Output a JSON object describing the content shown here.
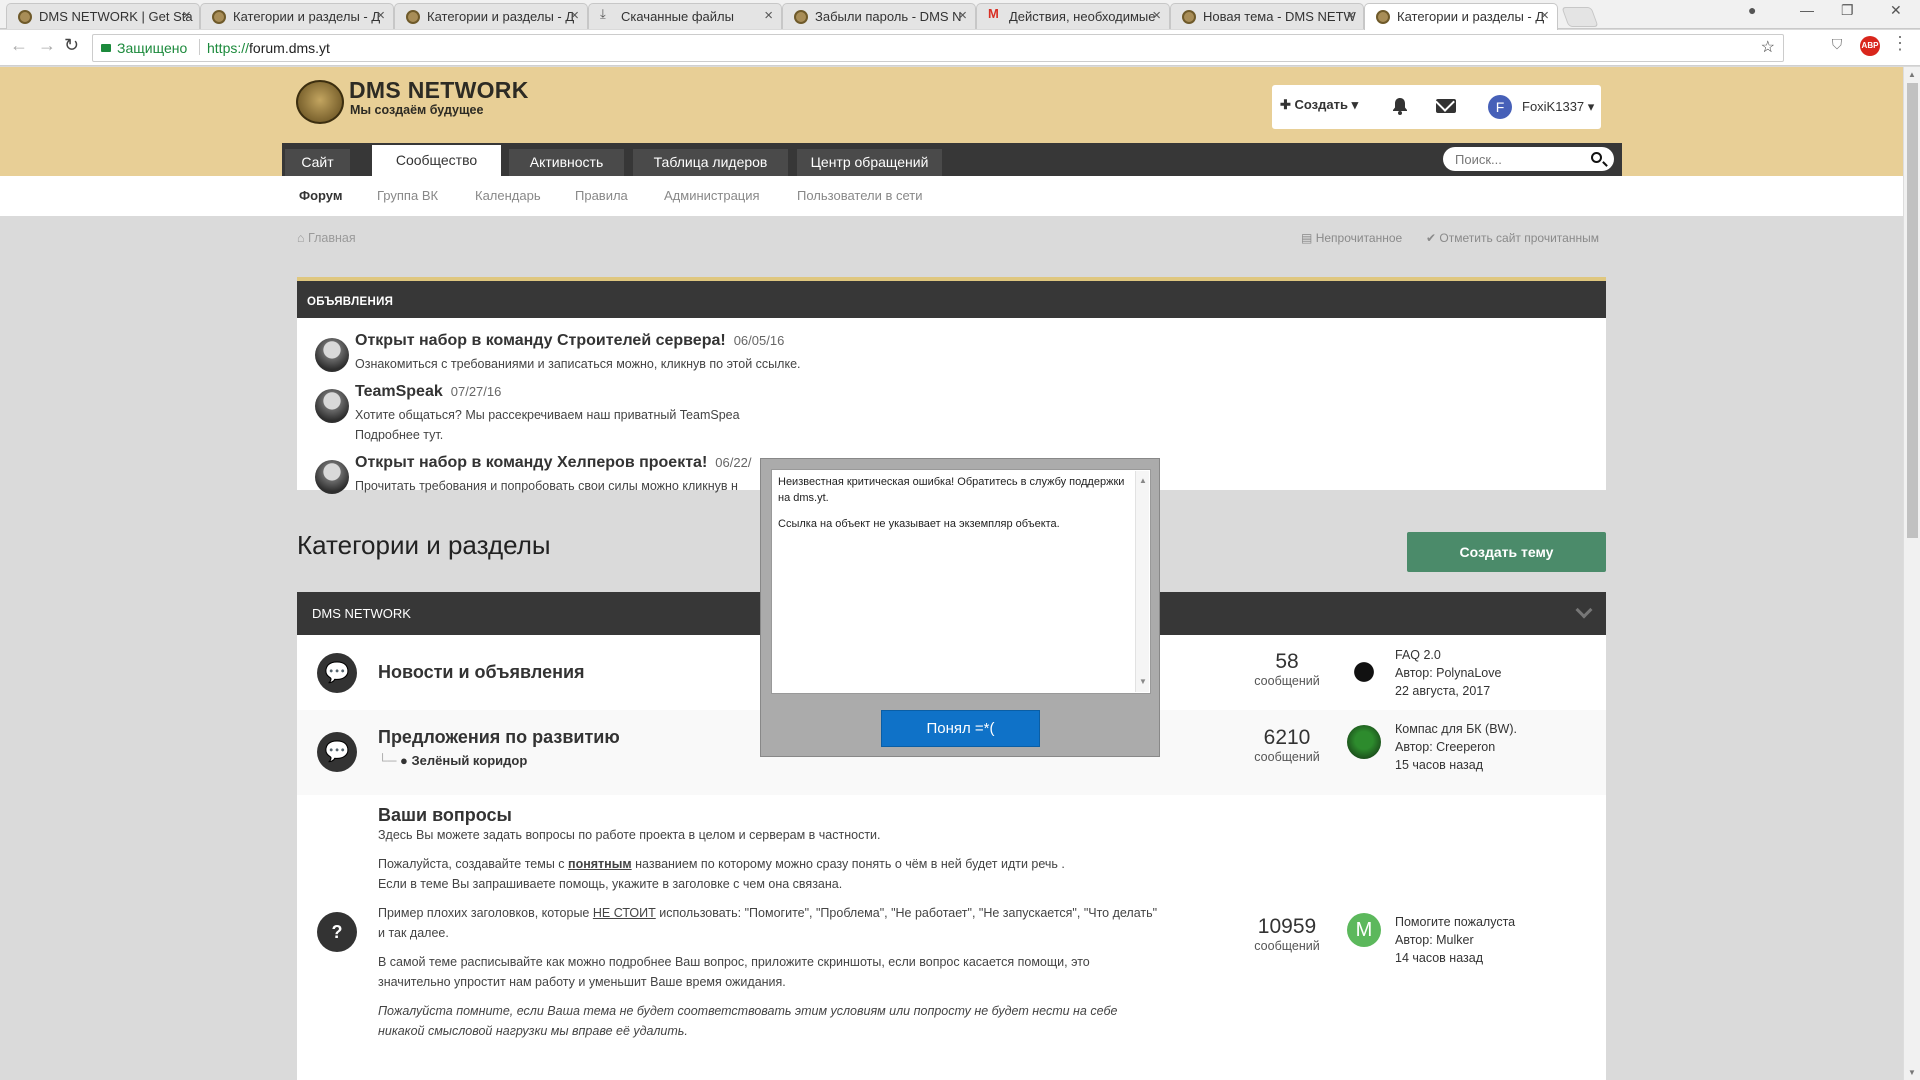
{
  "browser": {
    "tabs": [
      {
        "title": "DMS NETWORK | Get Sta"
      },
      {
        "title": "Категории и разделы - Д"
      },
      {
        "title": "Категории и разделы - Д"
      },
      {
        "title": "Скачанные файлы"
      },
      {
        "title": "Забыли пароль - DMS N"
      },
      {
        "title": "Действия, необходимые"
      },
      {
        "title": "Новая тема - DMS NETW"
      },
      {
        "title": "Категории и разделы - Д"
      }
    ],
    "secure_label": "Защищено",
    "url_scheme": "https://",
    "url_host": "forum.dms.yt"
  },
  "header": {
    "brand": "DMS NETWORK",
    "tagline": "Мы создаём будущее",
    "create_label": "Создать",
    "avatar_letter": "F",
    "username": "FoxiK1337"
  },
  "mainnav": {
    "tabs": [
      "Сайт",
      "Сообщество",
      "Активность",
      "Таблица лидеров",
      "Центр обращений"
    ],
    "search_placeholder": "Поиск..."
  },
  "subnav": [
    "Форум",
    "Группа ВК",
    "Календарь",
    "Правила",
    "Администрация",
    "Пользователи в сети"
  ],
  "breadcrumb": {
    "home": "Главная",
    "unread": "Непрочитанное",
    "mark_read": "Отметить сайт прочитанным"
  },
  "announcements": {
    "heading": "ОБЪЯВЛЕНИЯ",
    "items": [
      {
        "title": "Открыт набор в команду Строителей сервера!",
        "date": "06/05/16",
        "text": "Ознакомиться с требованиями и записаться можно, кликнув по этой ссылке."
      },
      {
        "title": "TeamSpeak",
        "date": "07/27/16",
        "text": "Хотите общаться? Мы рассекречиваем наш приватный TeamSpea",
        "text2": "Подробнее тут."
      },
      {
        "title": "Открыт набор в команду Хелперов проекта!",
        "date": "06/22/",
        "text": "Прочитать требования и попробовать свои силы можно кликнув н"
      }
    ]
  },
  "main": {
    "title": "Категории и разделы",
    "new_topic": "Создать тему",
    "category": "DMS NETWORK",
    "forums": [
      {
        "title": "Новости и объявления",
        "count": "58",
        "count_label": "сообщений",
        "last_title": "FAQ 2.0",
        "last_author": "Автор: PolynaLove",
        "last_time": "22 августа, 2017"
      },
      {
        "title": "Предложения по развитию",
        "sub": "Зелёный коридор",
        "count": "6210",
        "count_label": "сообщений",
        "last_title": "Компас для БК (BW).",
        "last_author": "Автор: Creeperon",
        "last_time": "15 часов назад"
      },
      {
        "title": "Ваши вопросы",
        "desc1": "Здесь Вы можете задать вопросы по работе проекта в целом и серверам в частности.",
        "desc2a": "Пожалуйста, создавайте темы с ",
        "desc2u": "понятным",
        "desc2b": " названием по которому можно сразу понять о чём в ней будет идти речь .",
        "desc2c": "Если в теме Вы запрашиваете помощь, укажите в заголовке с чем она связана.",
        "desc3a": "Пример плохих заголовков, которые ",
        "desc3u": "НЕ СТОИТ",
        "desc3b": " использовать: \"Помогите\",  \"Проблема\", \"Не работает\", \"Не запускается\", \"Что делать\" и так далее.",
        "desc4": "В самой теме расписывайте как можно подробнее Ваш вопрос, приложите скриншоты, если вопрос касается помощи, это значительно упростит нам работу и уменьшит Ваше время ожидания.",
        "desc5": "Пожалуйста помните, если Ваша тема не будет соответствовать этим условиям или попросту не будет нести на себе никакой смысловой нагрузки мы вправе её удалить.",
        "count": "10959",
        "count_label": "сообщений",
        "last_avatar": "M",
        "last_title": "Помогите пожалуста",
        "last_author": "Автор: Mulker",
        "last_time": "14 часов назад"
      }
    ]
  },
  "dialog": {
    "line1": "Неизвестная критическая ошибка! Обратитесь в службу поддержки на dms.yt.",
    "line2": "Ссылка на объект не указывает на экземпляр объекта.",
    "ok": "Понял =*("
  }
}
